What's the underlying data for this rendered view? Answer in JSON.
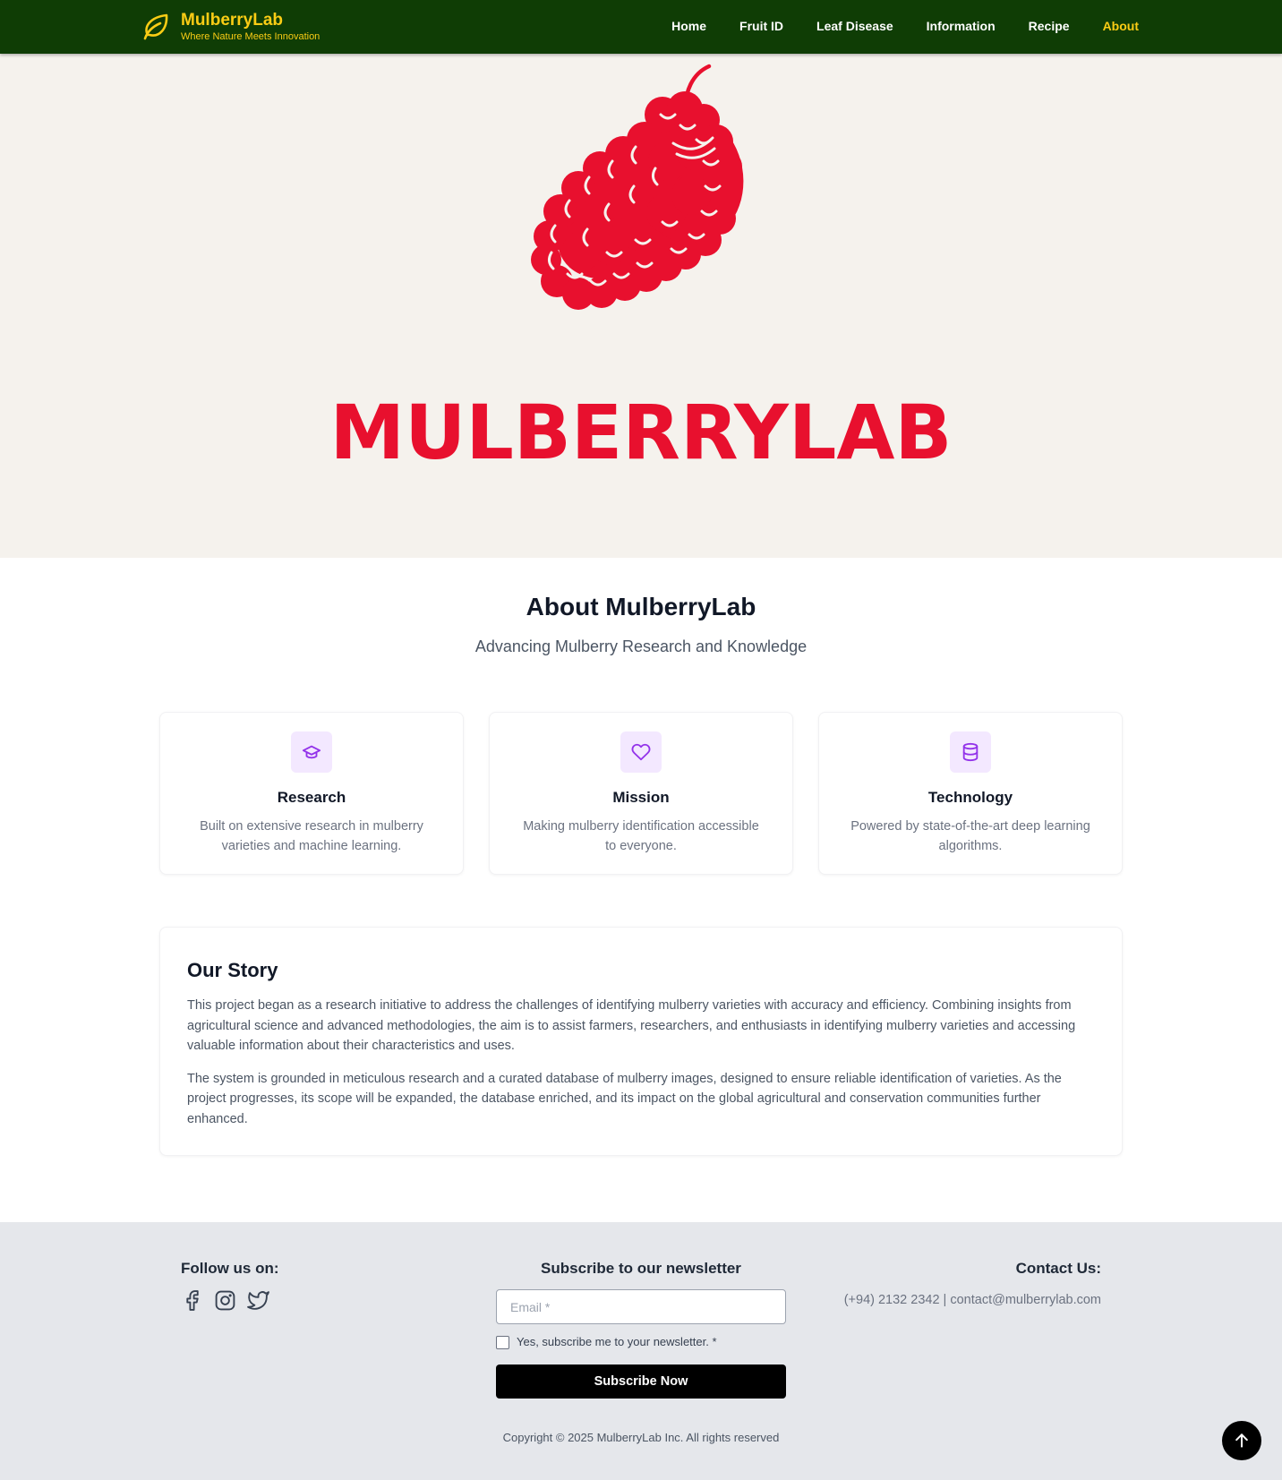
{
  "header": {
    "brand_name": "MulberryLab",
    "brand_tagline": "Where Nature Meets Innovation",
    "logo_icon": "leaf-icon",
    "nav": [
      {
        "label": "Home",
        "active": false
      },
      {
        "label": "Fruit ID",
        "active": false
      },
      {
        "label": "Leaf Disease",
        "active": false
      },
      {
        "label": "Information",
        "active": false
      },
      {
        "label": "Recipe",
        "active": false
      },
      {
        "label": "About",
        "active": true
      }
    ]
  },
  "hero": {
    "illustration": "mulberry-illustration",
    "wordmark": "MULBERRYLAB"
  },
  "about": {
    "title": "About MulberryLab",
    "subtitle": "Advancing Mulberry Research and Knowledge",
    "cards": [
      {
        "icon": "graduation-cap-icon",
        "title": "Research",
        "text": "Built on extensive research in mulberry varieties and machine learning."
      },
      {
        "icon": "heart-icon",
        "title": "Mission",
        "text": "Making mulberry identification accessible to everyone."
      },
      {
        "icon": "database-icon",
        "title": "Technology",
        "text": "Powered by state-of-the-art deep learning algorithms."
      }
    ]
  },
  "story": {
    "title": "Our Story",
    "paragraphs": [
      "This project began as a research initiative to address the challenges of identifying mulberry varieties with accuracy and efficiency. Combining insights from agricultural science and advanced methodologies, the aim is to assist farmers, researchers, and enthusiasts in identifying mulberry varieties and accessing valuable information about their characteristics and uses.",
      "The system is grounded in meticulous research and a curated database of mulberry images, designed to ensure reliable identification of varieties. As the project progresses, its scope will be expanded, the database enriched, and its impact on the global agricultural and conservation communities further enhanced."
    ]
  },
  "footer": {
    "follow_title": "Follow us on:",
    "social_icons": [
      "facebook-icon",
      "instagram-icon",
      "twitter-icon"
    ],
    "newsletter_title": "Subscribe to our newsletter",
    "email_placeholder": "Email *",
    "email_value": "",
    "checkbox_label": "Yes, subscribe me to your newsletter. *",
    "checkbox_checked": false,
    "subscribe_label": "Subscribe Now",
    "contact_title": "Contact Us:",
    "contact_text": "(+94) 2132 2342 | contact@mulberrylab.com",
    "copyright": "Copyright © 2025 MulberryLab Inc. All rights reserved"
  },
  "scroll_top_icon": "arrow-up-icon",
  "colors": {
    "nav_bg": "#0f3d05",
    "brand_accent": "#facc15",
    "hero_bg": "#f5f2ed",
    "mulberry_red": "#e8102e",
    "icon_purple": "#9333ea",
    "icon_bg": "#f3e8ff",
    "footer_bg": "#e5e7eb"
  }
}
